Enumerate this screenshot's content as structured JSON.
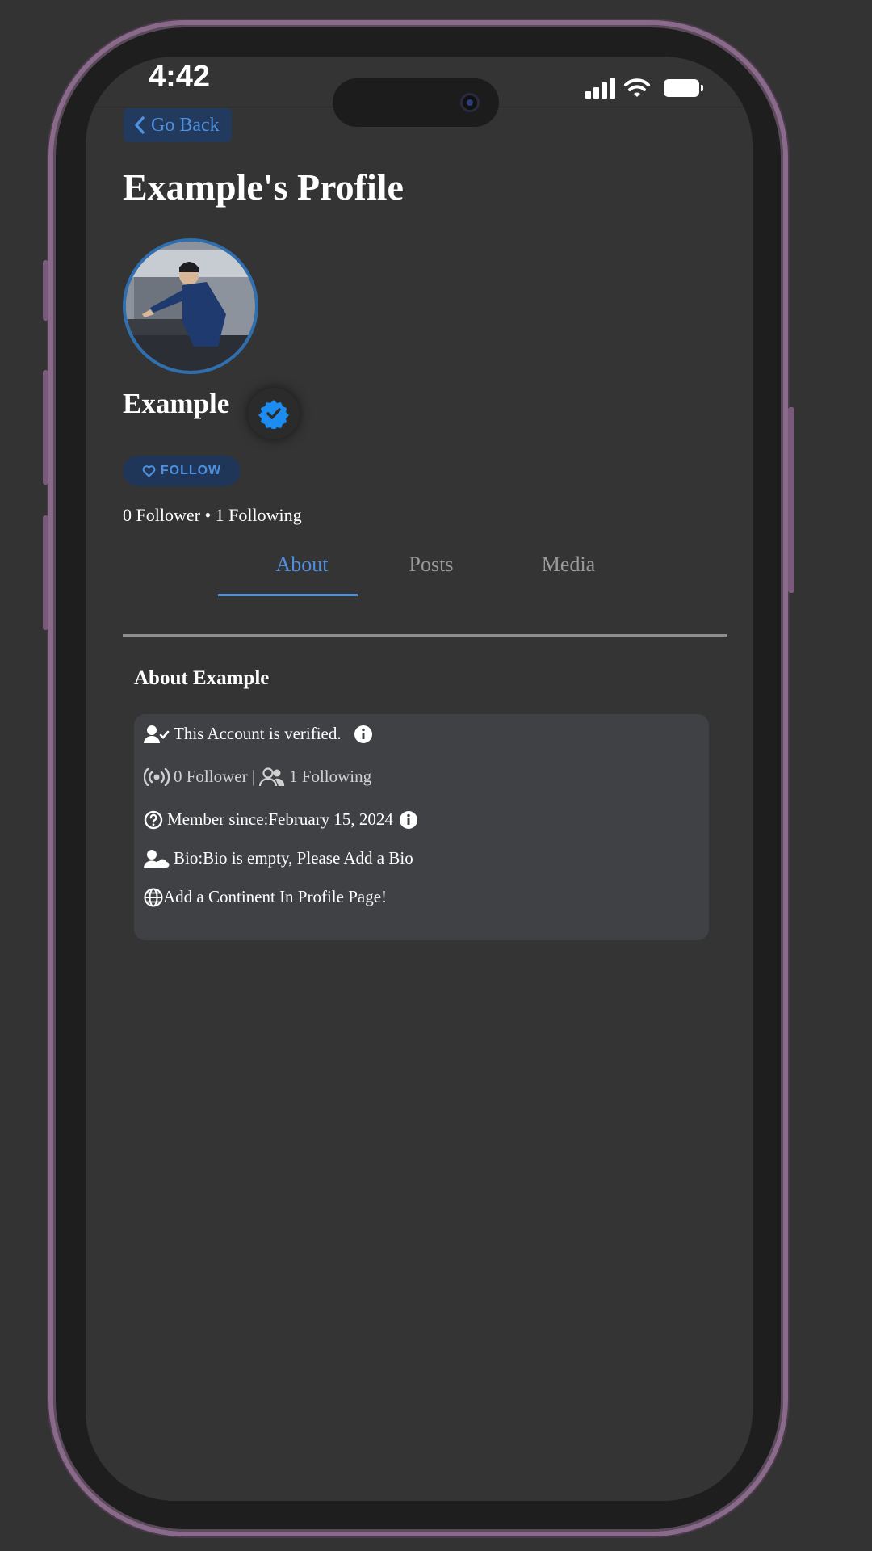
{
  "status_bar": {
    "time": "4:42"
  },
  "nav": {
    "back_label": "Go Back"
  },
  "profile": {
    "page_title": "Example's Profile",
    "username": "Example",
    "follow_label": "FOLLOW",
    "counts_text": "0 Follower • 1 Following"
  },
  "tabs": [
    {
      "label": "About",
      "active": true
    },
    {
      "label": "Posts",
      "active": false
    },
    {
      "label": "Media",
      "active": false
    }
  ],
  "about": {
    "heading": "About Example",
    "verified_text": "This Account is verified.",
    "follower_text": "0 Follower |",
    "following_text": "1 Following",
    "member_since_text": "Member since:February 15, 2024",
    "bio_text": "Bio:Bio is empty, Please Add a Bio",
    "continent_text": "Add a Continent In Profile Page!"
  },
  "colors": {
    "accent": "#4f8fe0",
    "background": "#343434",
    "card": "#404144",
    "verified_badge": "#1d8cf0"
  },
  "icons": {
    "back": "chevron-left-icon",
    "verified": "verified-badge-icon",
    "follow": "heart-icon",
    "verified_user": "user-check-icon",
    "info": "info-icon",
    "broadcast": "broadcast-icon",
    "users": "users-icon",
    "question": "question-circle-icon",
    "user_bio": "user-cloud-icon",
    "globe": "globe-icon"
  }
}
